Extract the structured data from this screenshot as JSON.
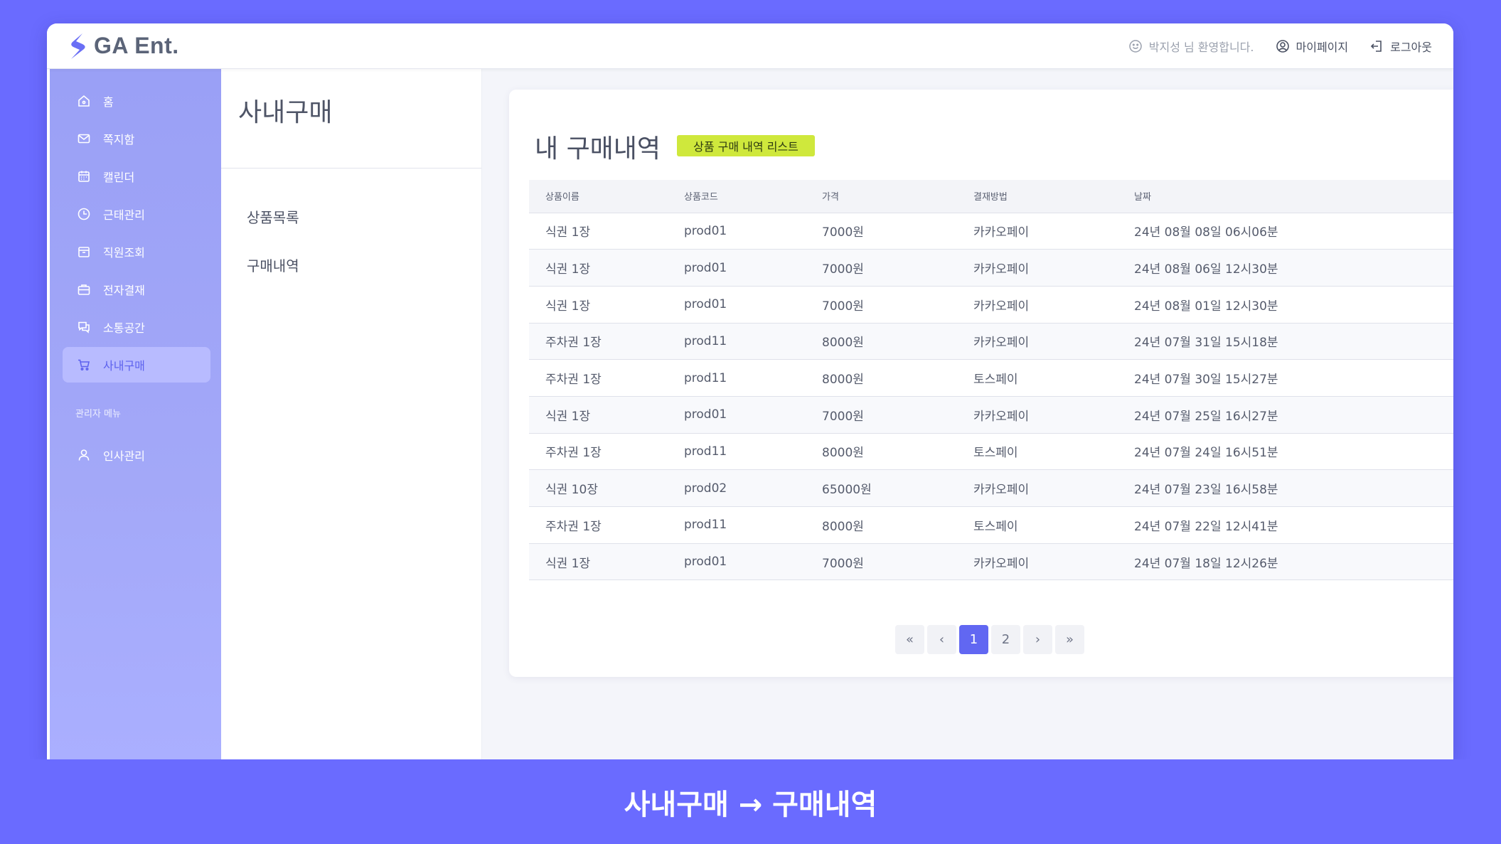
{
  "app": {
    "name": "GA Ent."
  },
  "topnav": {
    "welcome": "박지성 님 환영합니다.",
    "mypage": "마이페이지",
    "logout": "로그아웃"
  },
  "sidebar": {
    "items": [
      {
        "label": "홈",
        "icon": "home-icon"
      },
      {
        "label": "쪽지함",
        "icon": "mail-icon"
      },
      {
        "label": "캘린더",
        "icon": "calendar-icon"
      },
      {
        "label": "근태관리",
        "icon": "clock-icon"
      },
      {
        "label": "직원조회",
        "icon": "folder-icon"
      },
      {
        "label": "전자결재",
        "icon": "briefcase-icon"
      },
      {
        "label": "소통공간",
        "icon": "chat-icon"
      },
      {
        "label": "사내구매",
        "icon": "cart-icon",
        "active": true
      }
    ],
    "admin_section": "관리자 메뉴",
    "admin_items": [
      {
        "label": "인사관리",
        "icon": "user-icon"
      }
    ]
  },
  "submenu": {
    "title": "사내구매",
    "items": [
      "상품목록",
      "구매내역"
    ]
  },
  "main": {
    "title": "내 구매내역",
    "badge": "상품 구매 내역 리스트",
    "columns": [
      "상품이름",
      "상품코드",
      "가격",
      "결재방법",
      "날짜"
    ],
    "rows": [
      [
        "식권 1장",
        "prod01",
        "7000원",
        "카카오페이",
        "24년 08월 08일 06시06분"
      ],
      [
        "식권 1장",
        "prod01",
        "7000원",
        "카카오페이",
        "24년 08월 06일 12시30분"
      ],
      [
        "식권 1장",
        "prod01",
        "7000원",
        "카카오페이",
        "24년 08월 01일 12시30분"
      ],
      [
        "주차권 1장",
        "prod11",
        "8000원",
        "카카오페이",
        "24년 07월 31일 15시18분"
      ],
      [
        "주차권 1장",
        "prod11",
        "8000원",
        "토스페이",
        "24년 07월 30일 15시27분"
      ],
      [
        "식권 1장",
        "prod01",
        "7000원",
        "카카오페이",
        "24년 07월 25일 16시27분"
      ],
      [
        "주차권 1장",
        "prod11",
        "8000원",
        "토스페이",
        "24년 07월 24일 16시51분"
      ],
      [
        "식권 10장",
        "prod02",
        "65000원",
        "카카오페이",
        "24년 07월 23일 16시58분"
      ],
      [
        "주차권 1장",
        "prod11",
        "8000원",
        "토스페이",
        "24년 07월 22일 12시41분"
      ],
      [
        "식권 1장",
        "prod01",
        "7000원",
        "카카오페이",
        "24년 07월 18일 12시26분"
      ]
    ],
    "pagination": {
      "first": "«",
      "prev": "‹",
      "pages": [
        "1",
        "2"
      ],
      "current": "1",
      "next": "›",
      "last": "»"
    }
  },
  "caption": "사내구매 → 구매내역",
  "colors": {
    "background": "#6a6bff",
    "sidebar": "#a0a5f7",
    "accent": "#6167f2",
    "badge": "#cfe83c"
  }
}
